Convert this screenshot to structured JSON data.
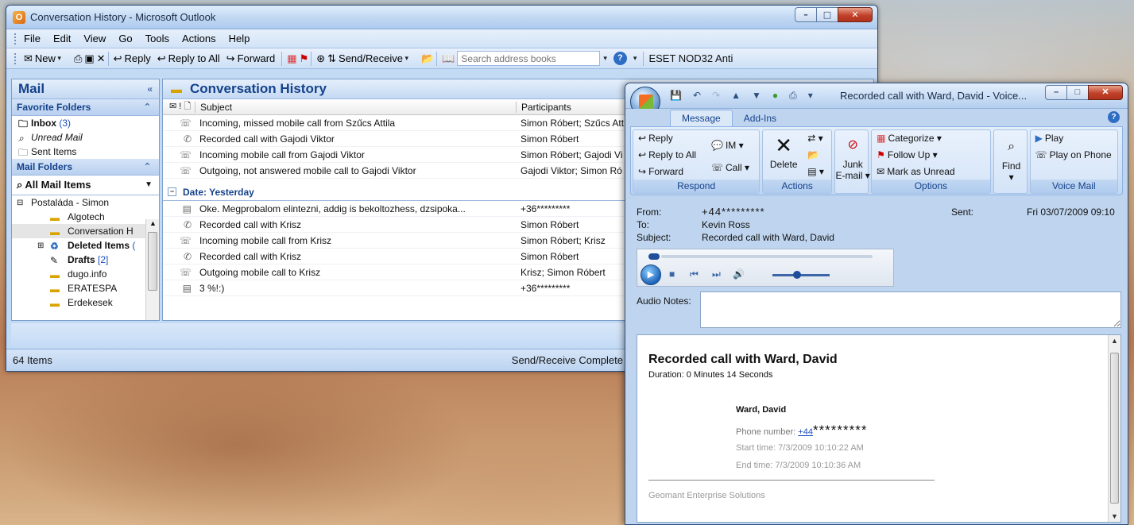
{
  "main_window": {
    "title": "Conversation History - Microsoft Outlook",
    "menu": [
      "File",
      "Edit",
      "View",
      "Go",
      "Tools",
      "Actions",
      "Help"
    ],
    "toolbar": {
      "new": "New",
      "reply": "Reply",
      "reply_all": "Reply to All",
      "forward": "Forward",
      "send_receive": "Send/Receive",
      "search_placeholder": "Search address books",
      "eset": "ESET NOD32 Anti"
    },
    "nav": {
      "header": "Mail",
      "favorites_title": "Favorite Folders",
      "favorites": [
        {
          "label": "Inbox",
          "count": "(3)"
        },
        {
          "label": "Unread Mail",
          "count": ""
        },
        {
          "label": "Sent Items",
          "count": ""
        }
      ],
      "mail_folders_title": "Mail Folders",
      "all_mail": "All Mail Items",
      "tree": [
        {
          "label": "Postaláda - Simon",
          "count": ""
        },
        {
          "label": "Algotech",
          "count": ""
        },
        {
          "label": "Conversation H",
          "count": ""
        },
        {
          "label": "Deleted Items",
          "count": "("
        },
        {
          "label": "Drafts",
          "count": "[2]"
        },
        {
          "label": "dugo.info",
          "count": ""
        },
        {
          "label": "ERATESPA",
          "count": ""
        },
        {
          "label": "Erdekesek",
          "count": ""
        }
      ]
    },
    "list": {
      "title": "Conversation History",
      "col_subject": "Subject",
      "col_participants": "Participants",
      "group_today_rows": [
        {
          "subject": "Incoming, missed mobile call from Szűcs Attila",
          "participants": "Simon Róbert; Szűcs Att"
        },
        {
          "subject": "Recorded call with Gajodi Viktor",
          "participants": "Simon Róbert"
        },
        {
          "subject": "Incoming mobile call from Gajodi Viktor",
          "participants": "Simon Róbert; Gajodi Vi"
        },
        {
          "subject": "Outgoing, not answered mobile call to Gajodi Viktor",
          "participants": "Gajodi Viktor; Simon Ró"
        }
      ],
      "group_yesterday_label": "Date: Yesterday",
      "group_yesterday_rows": [
        {
          "subject": "Oke. Megprobalom elintezni, addig is bekoltozhess, dzsipoka...",
          "participants": "+36*********"
        },
        {
          "subject": "Recorded call with Krisz",
          "participants": "Simon Róbert"
        },
        {
          "subject": "Incoming mobile call from Krisz",
          "participants": "Simon Róbert; Krisz"
        },
        {
          "subject": "Recorded call with Krisz",
          "participants": "Simon Róbert"
        },
        {
          "subject": "Outgoing mobile call to Krisz",
          "participants": "Krisz; Simon Róbert"
        },
        {
          "subject": "3 %!:)",
          "participants": "+36*********"
        }
      ]
    },
    "status": {
      "items": "64 Items",
      "sync": "Send/Receive Complete"
    }
  },
  "message_window": {
    "title": "Recorded call with Ward, David - Voice...",
    "tabs": [
      "Message",
      "Add-Ins"
    ],
    "ribbon": {
      "respond_label": "Respond",
      "reply": "Reply",
      "reply_all": "Reply to All",
      "forward": "Forward",
      "im": "IM",
      "call": "Call",
      "actions_label": "Actions",
      "delete": "Delete",
      "junk": "Junk",
      "junk2": "E-mail",
      "options_label": "Options",
      "categorize": "Categorize",
      "follow_up": "Follow Up",
      "mark_unread": "Mark as Unread",
      "find": "Find",
      "voicemail_label": "Voice Mail",
      "play": "Play",
      "play_phone": "Play on Phone"
    },
    "header": {
      "from_label": "From:",
      "from_value": "+44*********",
      "to_label": "To:",
      "to_value": "Kevin Ross",
      "subject_label": "Subject:",
      "subject_value": "Recorded call with Ward, David",
      "sent_label": "Sent:",
      "sent_value": "Fri 03/07/2009 09:10"
    },
    "audio_notes_label": "Audio Notes:",
    "body": {
      "title": "Recorded call with Ward, David",
      "duration": "Duration: 0 Minutes 14 Seconds",
      "name": "Ward, David",
      "phone_label": "Phone number:",
      "phone_link": "+44",
      "phone_masked": "*********",
      "start": "Start time: 7/3/2009 10:10:22 AM",
      "end": "End time: 7/3/2009 10:10:36 AM",
      "footer": "Geomant Enterprise Solutions"
    }
  }
}
